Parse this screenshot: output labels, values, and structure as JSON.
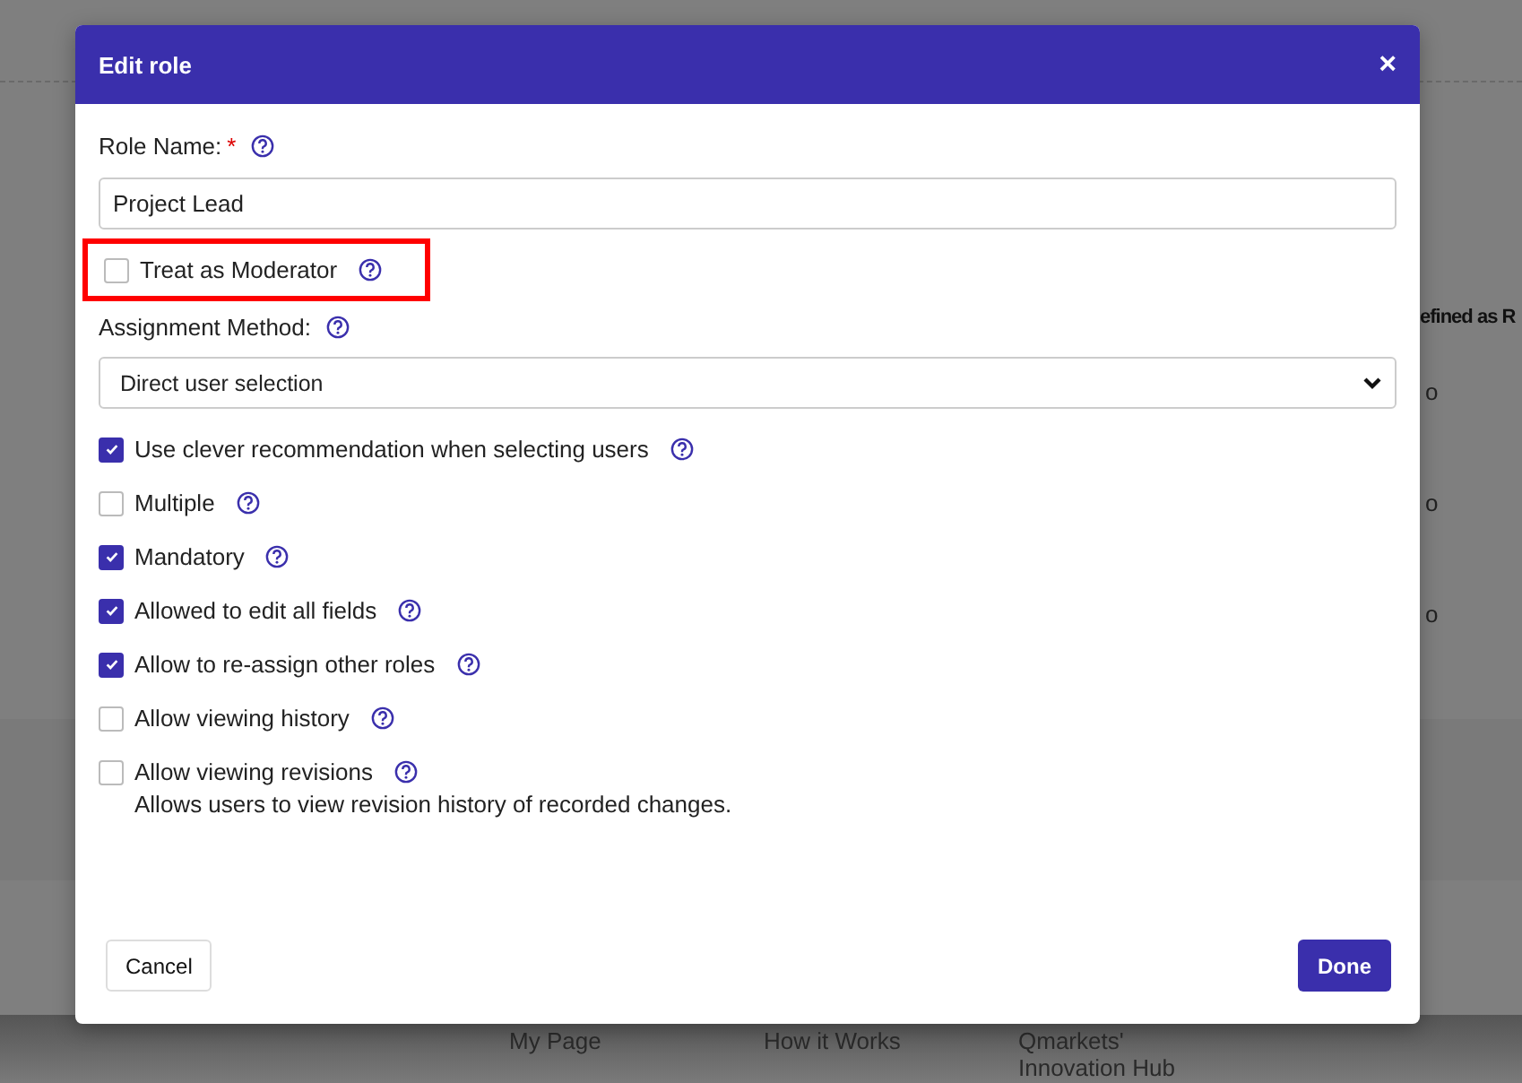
{
  "page": {
    "table_header": "efined as R",
    "table_cells": [
      "o",
      "o",
      "o"
    ],
    "footer_columns": [
      [
        "My Page"
      ],
      [
        "How it Works"
      ],
      [
        "Qmarkets' Innovation Hub"
      ]
    ]
  },
  "dialog": {
    "title": "Edit role",
    "close": "×",
    "role_name": {
      "label": "Role Name:",
      "required": "*",
      "value": "Project Lead"
    },
    "moderator": {
      "label": "Treat as Moderator",
      "checked": false,
      "highlighted": true
    },
    "assignment": {
      "label": "Assignment Method:",
      "value": "Direct user selection"
    },
    "options": [
      {
        "label": "Use clever recommendation when selecting users",
        "checked": true
      },
      {
        "label": "Multiple",
        "checked": false
      },
      {
        "label": "Mandatory",
        "checked": true
      },
      {
        "label": "Allowed to edit all fields",
        "checked": true
      },
      {
        "label": "Allow to re-assign other roles",
        "checked": true
      },
      {
        "label": "Allow viewing history",
        "checked": false
      },
      {
        "label": "Allow viewing revisions",
        "checked": false,
        "description": "Allows users to view revision history of recorded changes."
      }
    ],
    "buttons": {
      "cancel": "Cancel",
      "done": "Done"
    }
  }
}
